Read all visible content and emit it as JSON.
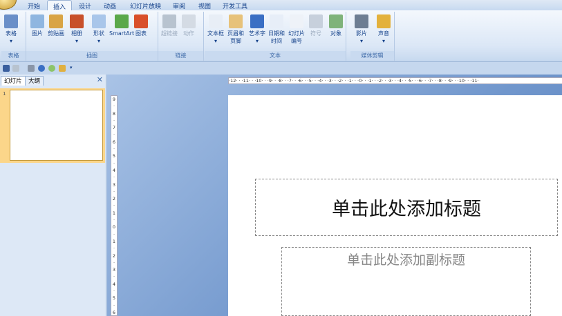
{
  "tabs": [
    "开始",
    "插入",
    "设计",
    "动画",
    "幻灯片放映",
    "审阅",
    "视图",
    "开发工具"
  ],
  "active_tab": "插入",
  "groups": [
    {
      "label": "表格",
      "buttons": [
        {
          "label": "表格",
          "sub": "▾",
          "color": "#6a8fc8"
        }
      ]
    },
    {
      "label": "插图",
      "buttons": [
        {
          "label": "图片",
          "color": "#8fb6e0"
        },
        {
          "label": "剪贴画",
          "color": "#d9a445"
        },
        {
          "label": "相册",
          "sub": "▾",
          "color": "#c8502a"
        },
        {
          "label": "形状",
          "sub": "▾",
          "color": "#a9c6ea"
        },
        {
          "label": "SmartArt",
          "color": "#5aa84a"
        },
        {
          "label": "图表",
          "color": "#d94f2a"
        }
      ]
    },
    {
      "label": "链接",
      "buttons": [
        {
          "label": "超链接",
          "color": "#b8c3cf",
          "disabled": true
        },
        {
          "label": "动作",
          "color": "#d4dbe4",
          "disabled": true
        }
      ]
    },
    {
      "label": "文本",
      "buttons": [
        {
          "label": "文本框",
          "sub": "▾",
          "color": "#e8eef6"
        },
        {
          "label": "页眉和",
          "sub": "页脚",
          "color": "#e7c27a"
        },
        {
          "label": "艺术字",
          "sub": "▾",
          "color": "#3a6fc4"
        },
        {
          "label": "日期和",
          "sub": "时间",
          "color": "#e7eef8"
        },
        {
          "label": "幻灯片",
          "sub": "编号",
          "color": "#eef2f8"
        },
        {
          "label": "符号",
          "color": "#c7d0dc",
          "disabled": true
        },
        {
          "label": "对象",
          "color": "#7fb37a"
        }
      ]
    },
    {
      "label": "媒体剪辑",
      "buttons": [
        {
          "label": "影片",
          "sub": "▾",
          "color": "#6d7d92"
        },
        {
          "label": "声音",
          "sub": "▾",
          "color": "#e3b13c"
        }
      ]
    }
  ],
  "panel": {
    "tabs": [
      "幻灯片",
      "大纲"
    ],
    "close": "✕",
    "slide_number": "1"
  },
  "hruler": "·12· · ·11· · ·10· · ·9· · ·8· · ·7· · ·6· · ·5· · ·4· · ·3· · ·2· · ·1· · ·0· · ·1· · ·2· · ·3· · ·4· · ·5· · ·6· · ·7· · ·8· · ·9· · ·10· · ·11·",
  "vruler": [
    "9",
    "·",
    "8",
    "·",
    "7",
    "·",
    "6",
    "·",
    "5",
    "·",
    "4",
    "·",
    "3",
    "·",
    "2",
    "·",
    "1",
    "·",
    "0",
    "·",
    "1",
    "·",
    "2",
    "·",
    "3",
    "·",
    "4",
    "·",
    "5",
    "·",
    "6"
  ],
  "slide": {
    "title_placeholder": "单击此处添加标题",
    "subtitle_placeholder": "单击此处添加副标题"
  }
}
